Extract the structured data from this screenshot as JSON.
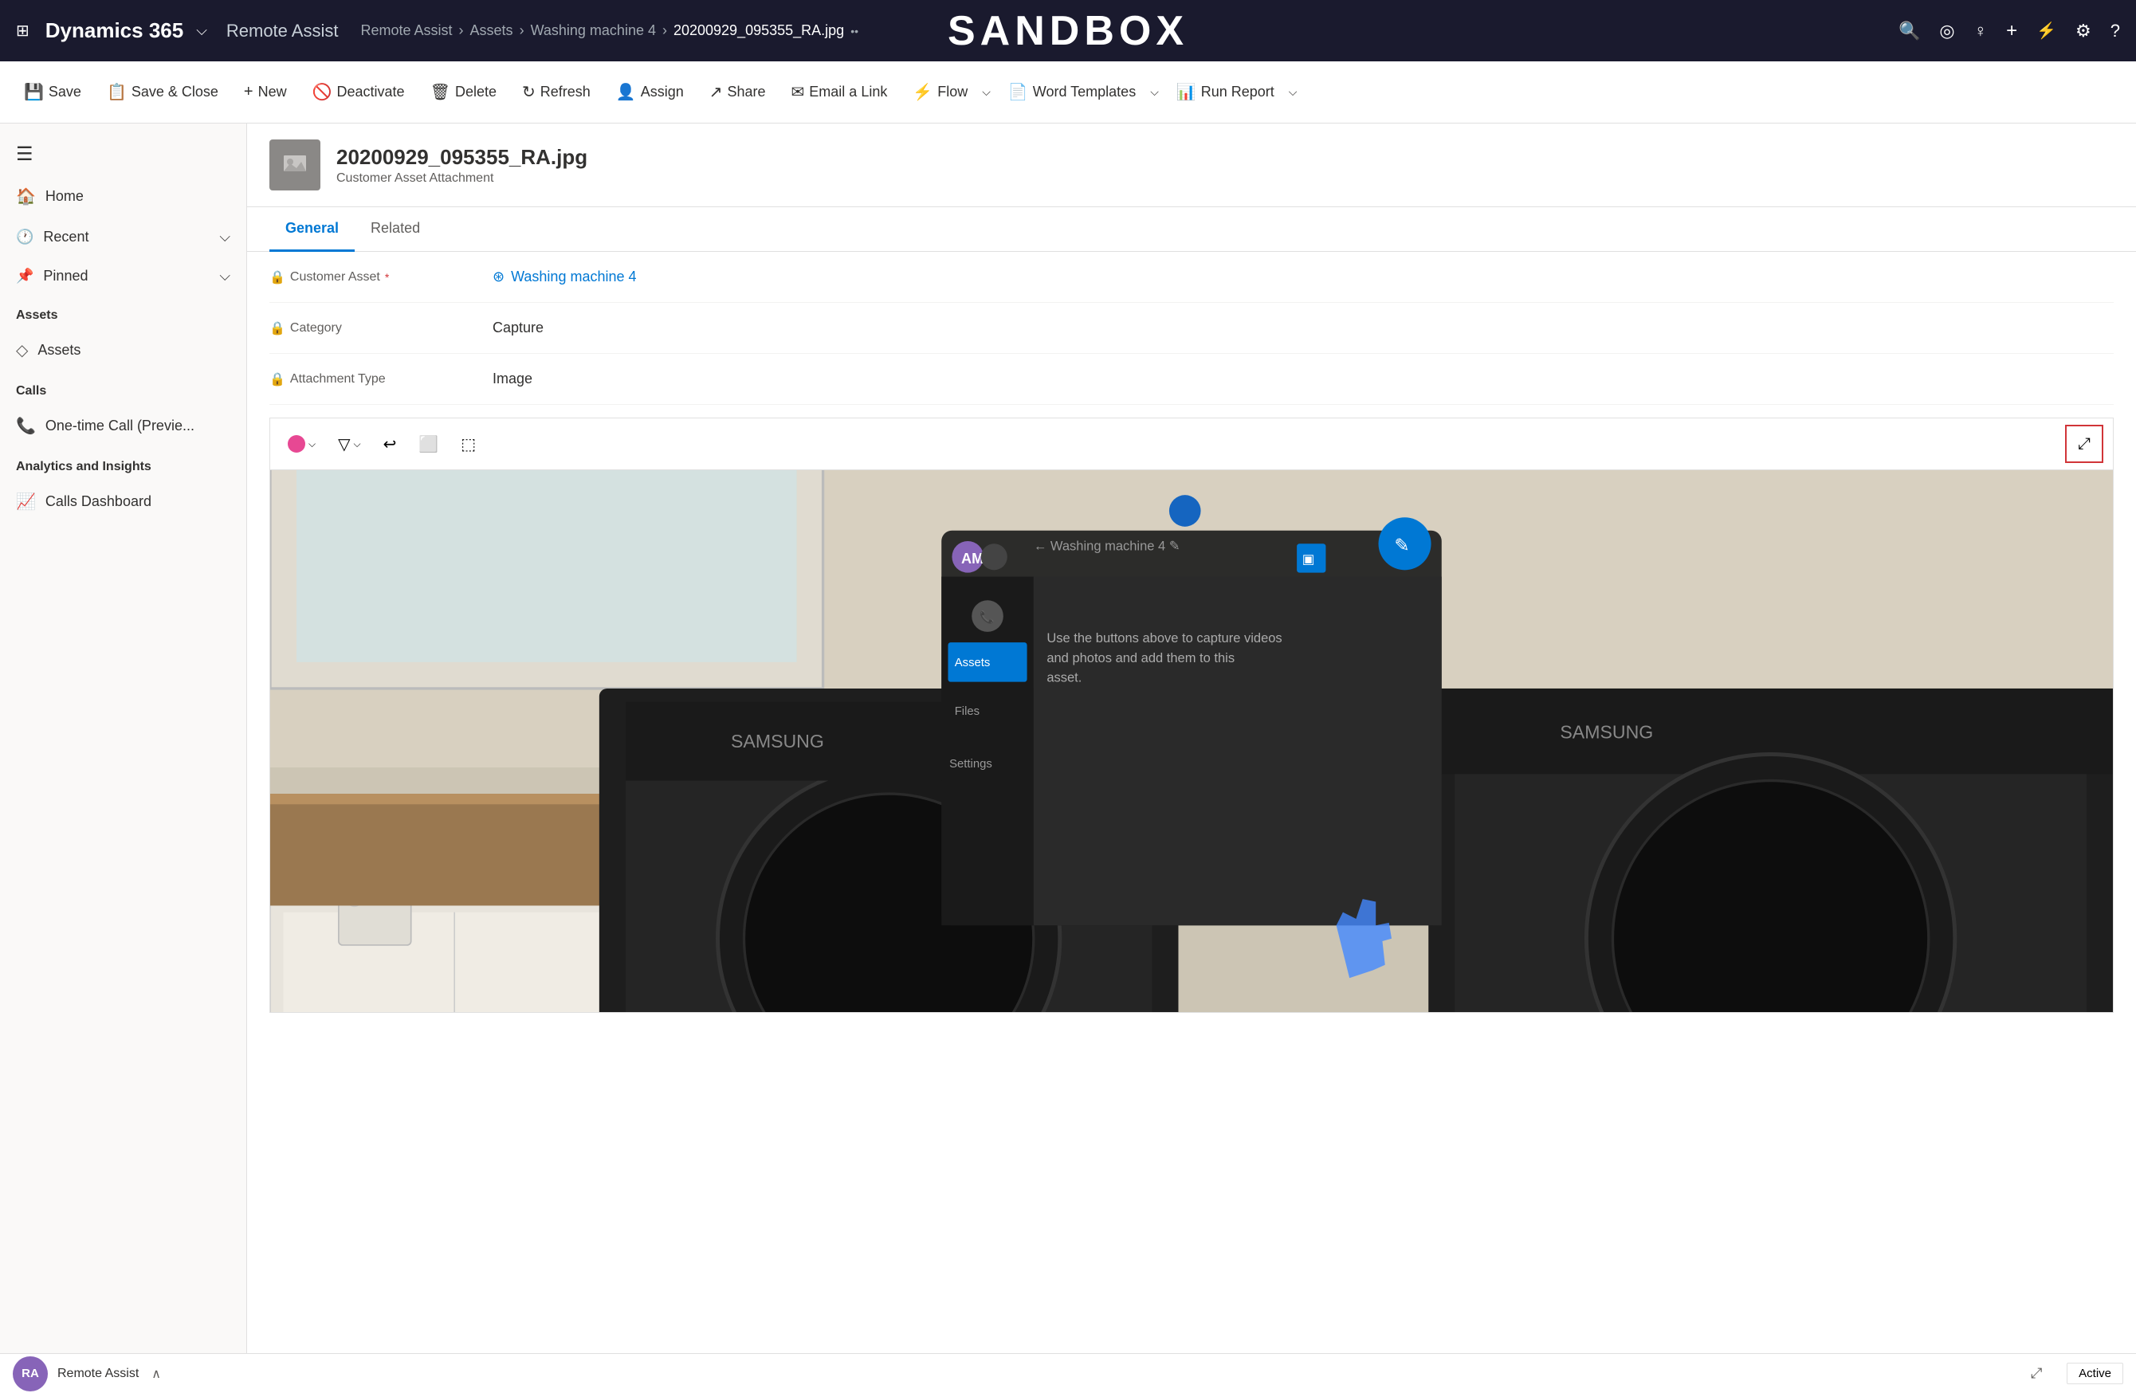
{
  "topNav": {
    "waffle": "⊞",
    "appName": "Dynamics 365",
    "appDropdown": "∨",
    "moduleName": "Remote Assist",
    "breadcrumb": [
      "Remote Assist",
      "Assets",
      "Washing machine 4",
      "20200929_095355_RA.jpg"
    ],
    "sandboxTitle": "SANDBOX",
    "icons": [
      "🔍",
      "⊙",
      "♀",
      "+",
      "⚡",
      "⚙",
      "?",
      "☰"
    ]
  },
  "commandBar": {
    "save": "Save",
    "saveClose": "Save & Close",
    "new": "New",
    "deactivate": "Deactivate",
    "delete": "Delete",
    "refresh": "Refresh",
    "assign": "Assign",
    "share": "Share",
    "emailLink": "Email a Link",
    "flow": "Flow",
    "wordTemplates": "Word Templates",
    "runReport": "Run Report"
  },
  "recordHeader": {
    "title": "20200929_095355_RA.jpg",
    "subtitle": "Customer Asset Attachment",
    "avatarText": "🖼"
  },
  "tabs": [
    {
      "label": "General",
      "active": true
    },
    {
      "label": "Related",
      "active": false
    }
  ],
  "formFields": [
    {
      "label": "Customer Asset",
      "required": true,
      "value": "Washing machine 4",
      "type": "link",
      "lockIcon": true
    },
    {
      "label": "Category",
      "required": false,
      "value": "Capture",
      "type": "text",
      "lockIcon": true
    },
    {
      "label": "Attachment Type",
      "required": false,
      "value": "Image",
      "type": "text",
      "lockIcon": true
    }
  ],
  "sidebar": {
    "toggle": "☰",
    "home": "Home",
    "recent": "Recent",
    "pinned": "Pinned",
    "sections": [
      {
        "label": "Assets",
        "items": [
          "Assets"
        ]
      },
      {
        "label": "Calls",
        "items": [
          "One-time Call (Previe..."
        ]
      },
      {
        "label": "Analytics and Insights",
        "items": [
          "Calls Dashboard"
        ]
      }
    ]
  },
  "imageToolbar": {
    "colorDot": "#e74893",
    "tools": [
      "▽",
      "↩",
      "⬜",
      "⬚"
    ]
  },
  "statusBar": {
    "expandIcon": "⤢",
    "status": "Active",
    "userInitials": "RA",
    "appName": "Remote Assist",
    "collapseIcon": "∧"
  }
}
